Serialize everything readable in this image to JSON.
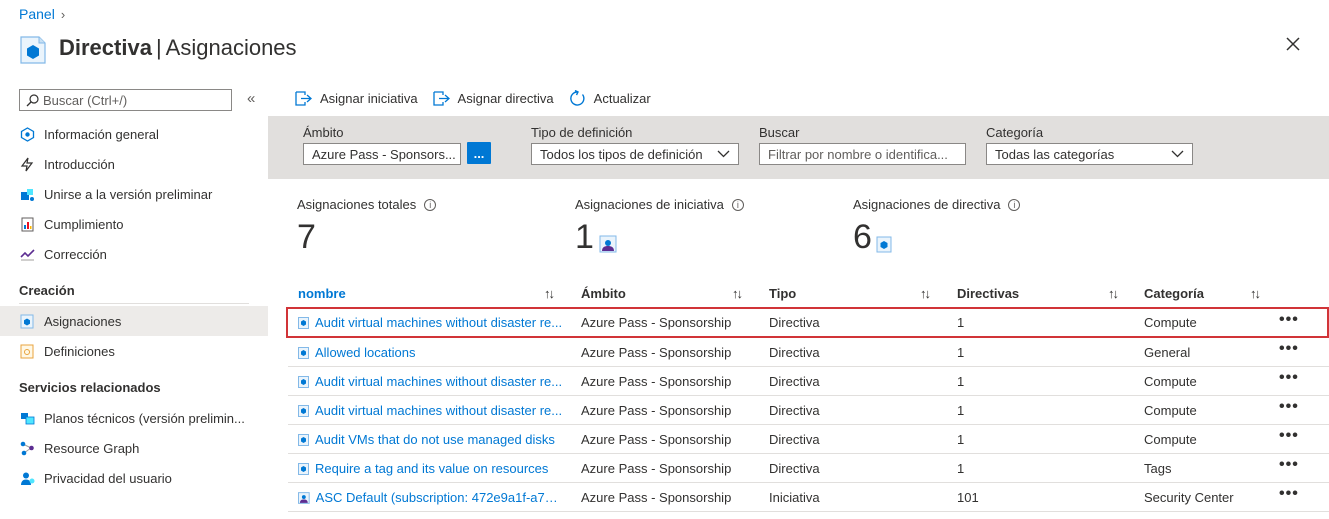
{
  "breadcrumb": {
    "root": "Panel"
  },
  "header": {
    "title_bold": "Directiva",
    "title_sep": "|",
    "title_rest": "Asignaciones"
  },
  "sidebar": {
    "search_placeholder": "Buscar (Ctrl+/)",
    "top_items": [
      {
        "label": "Información general",
        "icon": "overview-icon"
      },
      {
        "label": "Introducción",
        "icon": "lightning-icon"
      },
      {
        "label": "Unirse a la versión preliminar",
        "icon": "preview-icon"
      },
      {
        "label": "Cumplimiento",
        "icon": "compliance-icon"
      },
      {
        "label": "Corrección",
        "icon": "remediation-icon"
      }
    ],
    "section_authoring": "Creación",
    "authoring_items": [
      {
        "label": "Asignaciones",
        "icon": "assignments-icon"
      },
      {
        "label": "Definiciones",
        "icon": "definitions-icon"
      }
    ],
    "section_related": "Servicios relacionados",
    "related_items": [
      {
        "label": "Planos técnicos (versión prelimin...",
        "icon": "blueprints-icon"
      },
      {
        "label": "Resource Graph",
        "icon": "resource-graph-icon"
      },
      {
        "label": "Privacidad del usuario",
        "icon": "user-privacy-icon"
      }
    ]
  },
  "toolbar": {
    "assign_initiative": "Asignar iniciativa",
    "assign_policy": "Asignar directiva",
    "refresh": "Actualizar"
  },
  "filters": {
    "scope_label": "Ámbito",
    "scope_value": "Azure Pass - Sponsors...",
    "scope_button": "...",
    "definition_type_label": "Tipo de definición",
    "definition_type_value": "Todos los tipos de definición",
    "search_label": "Buscar",
    "search_placeholder": "Filtrar por nombre o identifica...",
    "category_label": "Categoría",
    "category_value": "Todas las categorías"
  },
  "stats": {
    "total_label": "Asignaciones totales",
    "total_value": "7",
    "initiative_label": "Asignaciones de iniciativa",
    "initiative_value": "1",
    "policy_label": "Asignaciones de directiva",
    "policy_value": "6"
  },
  "table": {
    "columns": [
      "nombre",
      "Ámbito",
      "Tipo",
      "Directivas",
      "Categoría"
    ],
    "rows": [
      {
        "name": "Audit virtual machines without disaster re...",
        "scope": "Azure Pass - Sponsorship",
        "type": "Directiva",
        "policies": "1",
        "category": "Compute",
        "icon": "policy-icon",
        "selected": true
      },
      {
        "name": "Allowed locations",
        "scope": "Azure Pass - Sponsorship",
        "type": "Directiva",
        "policies": "1",
        "category": "General",
        "icon": "policy-icon"
      },
      {
        "name": "Audit virtual machines without disaster re...",
        "scope": "Azure Pass - Sponsorship",
        "type": "Directiva",
        "policies": "1",
        "category": "Compute",
        "icon": "policy-icon"
      },
      {
        "name": "Audit virtual machines without disaster re...",
        "scope": "Azure Pass - Sponsorship",
        "type": "Directiva",
        "policies": "1",
        "category": "Compute",
        "icon": "policy-icon"
      },
      {
        "name": "Audit VMs that do not use managed disks",
        "scope": "Azure Pass - Sponsorship",
        "type": "Directiva",
        "policies": "1",
        "category": "Compute",
        "icon": "policy-icon"
      },
      {
        "name": "Require a tag and its value on resources",
        "scope": "Azure Pass - Sponsorship",
        "type": "Directiva",
        "policies": "1",
        "category": "Tags",
        "icon": "policy-icon"
      },
      {
        "name": "ASC Default (subscription: 472e9a1f-a7a7...",
        "scope": "Azure Pass - Sponsorship",
        "type": "Iniciativa",
        "policies": "101",
        "category": "Security Center",
        "icon": "initiative-icon"
      }
    ],
    "more_label": "•••"
  },
  "colors": {
    "accent": "#0078d4",
    "selected_border": "#d13438",
    "filter_bg": "#e1dfdd"
  }
}
